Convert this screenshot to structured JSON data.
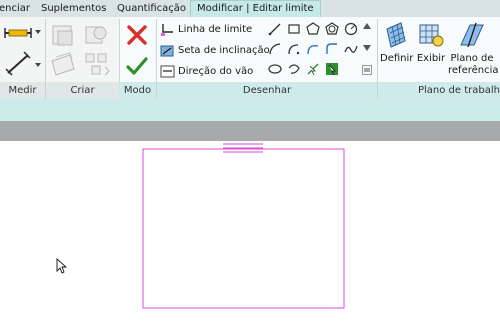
{
  "tabs": [
    {
      "label": "enciar",
      "active": false
    },
    {
      "label": "Suplementos",
      "active": false
    },
    {
      "label": "Quantificação",
      "active": false
    },
    {
      "label": "Modificar | Editar limite",
      "active": true
    }
  ],
  "panels": {
    "medir": "Medir",
    "criar": "Criar",
    "modo": "Modo",
    "desenhar": "Desenhar",
    "plano_trabalho": "Plano de trabalh"
  },
  "draw_tools": {
    "boundary_line": "Linha de limite",
    "slope_arrow": "Seta de inclinação",
    "span_direction": "Direção do vão"
  },
  "workplane_buttons": {
    "set": "Definir",
    "show": "Exibir",
    "ref_plane_line1": "Plano de",
    "ref_plane_line2": "referência"
  },
  "icons": {
    "cancel": "close-icon",
    "finish": "checkmark-icon"
  },
  "colors": {
    "sketch": "#d94bd9",
    "cancel": "#d8312b",
    "finish": "#2f8f2f",
    "ribbon_accent": "#cdebe9"
  }
}
